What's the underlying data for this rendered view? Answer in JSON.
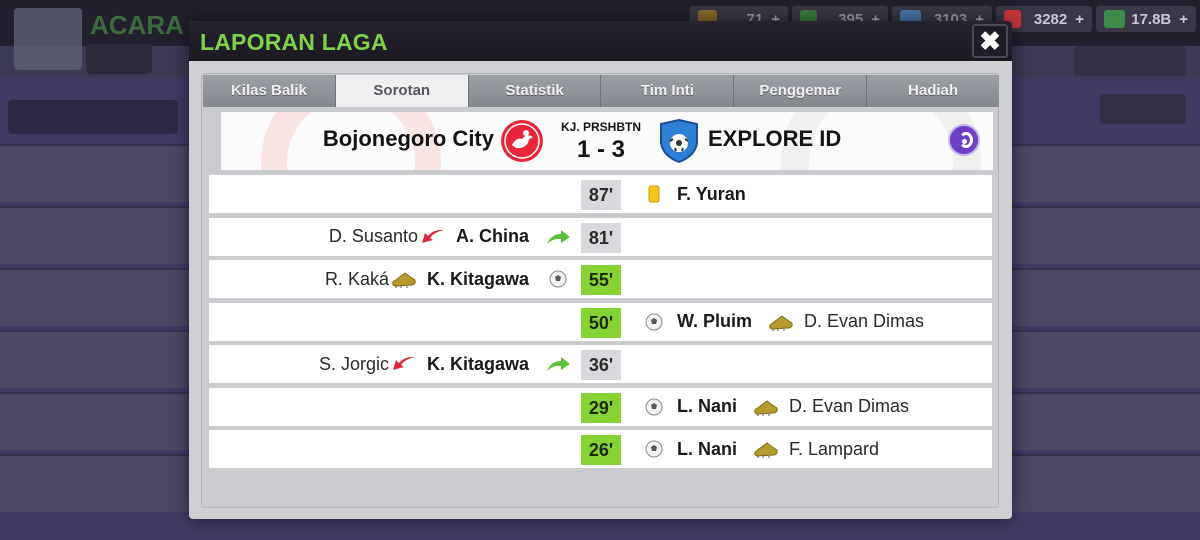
{
  "background": {
    "title": "ACARA",
    "resources": [
      {
        "icon": "coin-icon",
        "value": "71",
        "plus": "+"
      },
      {
        "icon": "cash-icon",
        "value": "395",
        "plus": "+"
      },
      {
        "icon": "tokens-icon",
        "value": "3103",
        "plus": "+"
      },
      {
        "icon": "medical-icon",
        "value": "3282",
        "plus": "+"
      },
      {
        "icon": "money-icon",
        "value": "17.8B",
        "plus": "+"
      }
    ]
  },
  "modal": {
    "title": "LAPORAN LAGA",
    "close_label": "✖",
    "tabs": [
      "Kilas Balik",
      "Sorotan",
      "Statistik",
      "Tim Inti",
      "Penggemar",
      "Hadiah"
    ],
    "active_tab": "Sorotan"
  },
  "match": {
    "home_team": "Bojonegoro City",
    "competition": "KJ. PRSHBTN",
    "score": "1 - 3",
    "away_team": "EXPLORE ID",
    "colors": {
      "home": "#e8263a",
      "away": "#2f7fd6",
      "goal_minute": "#86d334",
      "replay": "#6d3fc5"
    }
  },
  "events": [
    {
      "minute": "87'",
      "type": "yellow-card",
      "side": "away",
      "player": "F. Yuran",
      "secondary": ""
    },
    {
      "minute": "81'",
      "type": "substitution",
      "side": "home",
      "player": "A. China",
      "secondary": "D. Susanto"
    },
    {
      "minute": "55'",
      "type": "goal",
      "side": "home",
      "player": "K. Kitagawa",
      "secondary": "R. Kaká"
    },
    {
      "minute": "50'",
      "type": "goal",
      "side": "away",
      "player": "W. Pluim",
      "secondary": "D. Evan Dimas"
    },
    {
      "minute": "36'",
      "type": "substitution",
      "side": "home",
      "player": "K. Kitagawa",
      "secondary": "S. Jorgic"
    },
    {
      "minute": "29'",
      "type": "goal",
      "side": "away",
      "player": "L. Nani",
      "secondary": "D. Evan Dimas"
    },
    {
      "minute": "26'",
      "type": "goal",
      "side": "away",
      "player": "L. Nani",
      "secondary": "F. Lampard"
    }
  ]
}
